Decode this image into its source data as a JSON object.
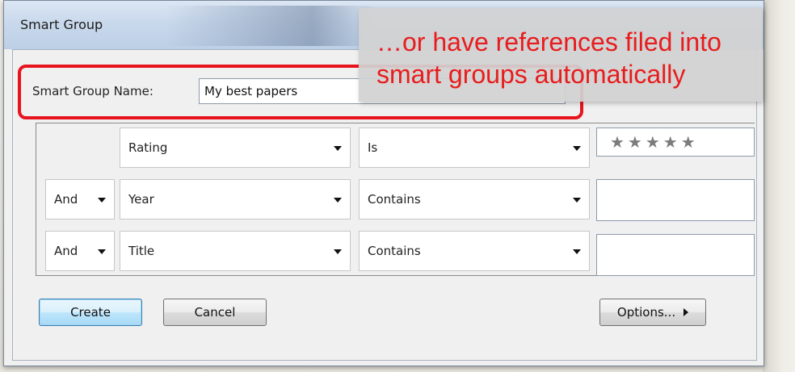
{
  "dialog": {
    "title": "Smart Group"
  },
  "name_field": {
    "label": "Smart Group Name:",
    "value": "My best papers"
  },
  "criteria": [
    {
      "conjunction": "",
      "field": "Rating",
      "operator": "Is",
      "value_type": "stars",
      "stars": "★★★★★"
    },
    {
      "conjunction": "And",
      "field": "Year",
      "operator": "Contains",
      "value_type": "text",
      "value": ""
    },
    {
      "conjunction": "And",
      "field": "Title",
      "operator": "Contains",
      "value_type": "text",
      "value": ""
    }
  ],
  "buttons": {
    "create": "Create",
    "cancel": "Cancel",
    "options": "Options..."
  },
  "callout": {
    "line1": "…or have references filed into",
    "line2": "smart groups automatically"
  },
  "colors": {
    "highlight": "#e8141d",
    "callout_text": "#e81c1c"
  },
  "icons": [
    "chevron-down-icon",
    "star-icon",
    "triangle-right-icon"
  ]
}
